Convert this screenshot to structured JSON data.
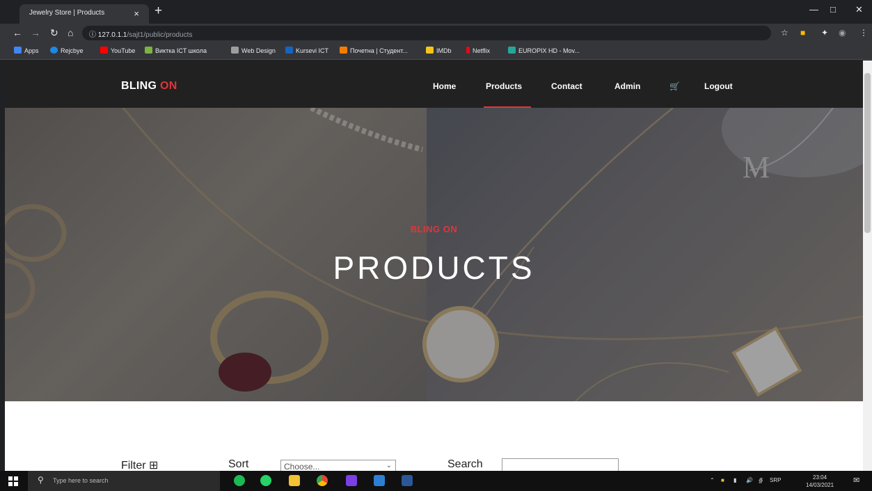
{
  "browser": {
    "tab_title": "Jewelry Store | Products",
    "tab_close": "×",
    "new_tab": "+",
    "url_host": "127.0.1.1",
    "url_path": "/sajt1/public/products",
    "bookmarks": [
      "Apps",
      "Rejcbye",
      "YouTube",
      "Виктка ICT школа",
      "Web Design",
      "Kursevi ICT",
      "Почетна | Студент...",
      "IMDb",
      "Netflix",
      "EUROPIX HD - Mov..."
    ],
    "colors": {
      "bookmarks": [
        "#4285f4",
        "#1e88e5",
        "#ff0000",
        "#7cb342",
        "#e0e0e0",
        "#1565c0",
        "#f57c00",
        "#f5c518",
        "#e50914",
        "#26a69a"
      ]
    }
  },
  "site": {
    "brand_main": "BLING",
    "brand_accent": "ON",
    "nav": [
      "Home",
      "Products",
      "Contact",
      "Admin",
      "Logout"
    ],
    "cart_icon": "cart-icon",
    "accent_color": "#e0363a"
  },
  "hero": {
    "kicker": "BLING ON",
    "title": "PRODUCTS"
  },
  "controls": {
    "filter_label": "Filter",
    "sort_label": "Sort",
    "sort_selected": "Choose...",
    "search_label": "Search"
  },
  "taskbar": {
    "search_placeholder": "Type here to search",
    "time": "23:04",
    "date": "14/03/2021",
    "lang": "SRP"
  }
}
